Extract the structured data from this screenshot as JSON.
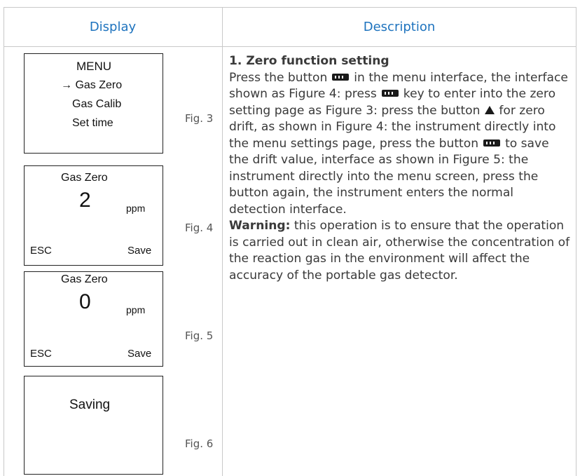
{
  "header": {
    "display": "Display",
    "description": "Description"
  },
  "figures": {
    "fig3": {
      "label": "Fig. 3",
      "menu_title": "MENU",
      "items": [
        "→ Gas Zero",
        "Gas Calib",
        "Set time"
      ]
    },
    "fig4": {
      "label": "Fig. 4",
      "title": "Gas Zero",
      "value": "2",
      "unit": "ppm",
      "esc": "ESC",
      "save": "Save"
    },
    "fig5": {
      "label": "Fig. 5",
      "title": "Gas Zero",
      "value": "0",
      "unit": "ppm",
      "esc": "ESC",
      "save": "Save"
    },
    "fig6": {
      "label": "Fig. 6",
      "text": "Saving"
    }
  },
  "description": {
    "heading": "1. Zero function setting",
    "t1": "Press the button",
    "t2": "in the menu interface, the interface shown as Figure 4: press",
    "t3": "key to enter into the zero setting page as Figure 3: press the button",
    "t4": "for zero drift, as shown in Figure 4: the instrument directly into the menu settings page, press the button",
    "t5": "to save the drift value, interface as shown in Figure 5: the instrument directly into the menu screen, press the button again, the instrument enters the normal detection interface.",
    "warning_label": "Warning:",
    "warning_text": "this operation is to ensure that the operation is carried out in clean air, otherwise the concentration of the reaction gas in the environment will affect the accuracy of the portable gas detector.",
    "icons": {
      "menu_key": "menu-key-icon",
      "up_key": "up-triangle-icon"
    }
  }
}
